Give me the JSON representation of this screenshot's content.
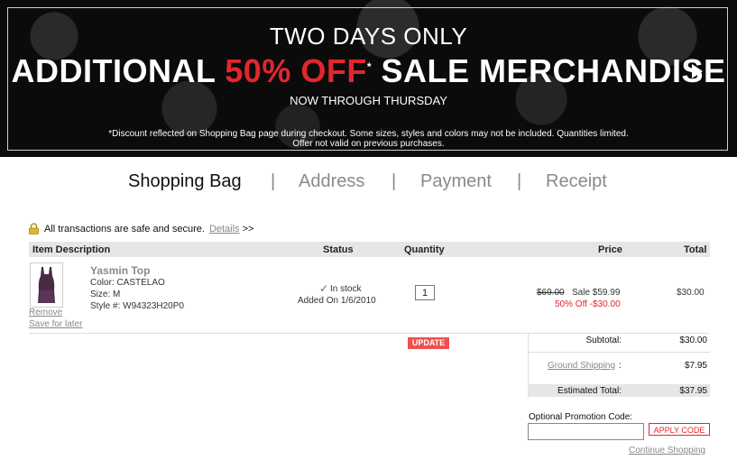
{
  "banner": {
    "line1": "TWO DAYS ONLY",
    "line2_a": "ADDITIONAL ",
    "line2_b": "50% OFF",
    "line2_star": "*",
    "line2_c": " SALE MERCHANDISE",
    "line3": "NOW THROUGH THURSDAY",
    "disclaimer1": "*Discount reflected on Shopping Bag page during checkout. Some sizes, styles and colors may not be included. Quantities limited.",
    "disclaimer2": "Offer not valid on previous purchases.",
    "accent_color": "#e3262e"
  },
  "steps": {
    "bag": "Shopping Bag",
    "address": "Address",
    "payment": "Payment",
    "receipt": "Receipt",
    "separator": "|"
  },
  "secure": {
    "text": "All transactions are safe and secure.",
    "details": "Details",
    "arrows": ">>"
  },
  "table": {
    "headers": {
      "item": "Item Description",
      "status": "Status",
      "quantity": "Quantity",
      "price": "Price",
      "total": "Total"
    },
    "item": {
      "name": "Yasmin Top",
      "color": "Color: CASTELAO",
      "size": "Size: M",
      "style": "Style #: W94323H20P0",
      "remove": "Remove",
      "save": "Save for later",
      "status_checkmark": "✓",
      "status": "In stock",
      "added": "Added On 1/6/2010",
      "quantity": "1",
      "price_original": "$69.00",
      "price_sale": "Sale $59.99",
      "price_discount": "50% Off -$30.00",
      "total": "$30.00"
    }
  },
  "actions": {
    "update": "UPDATE",
    "apply_code": "APPLY CODE",
    "continue": "Continue Shopping"
  },
  "summary": {
    "subtotal_label": "Subtotal:",
    "subtotal": "$30.00",
    "shipping_label": "Ground Shipping",
    "shipping_colon": ":",
    "shipping": "$7.95",
    "total_label": "Estimated Total:",
    "total": "$37.95"
  },
  "promo": {
    "label": "Optional Promotion Code:",
    "value": ""
  }
}
